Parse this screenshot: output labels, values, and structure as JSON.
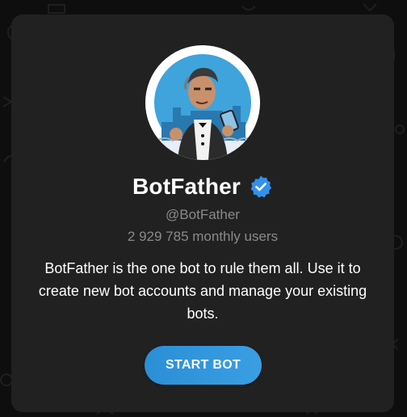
{
  "profile": {
    "name": "BotFather",
    "username": "@BotFather",
    "monthly_users": "2 929 785 monthly users",
    "description": "BotFather is the one bot to rule them all. Use it to create new bot accounts and manage your existing bots.",
    "verified": true,
    "avatar_icon": "botfather-avatar"
  },
  "actions": {
    "start_label": "START BOT"
  },
  "colors": {
    "background": "#0e0e0e",
    "card": "#212121",
    "accent": "#3390ec",
    "muted_text": "#8a8a8a"
  }
}
